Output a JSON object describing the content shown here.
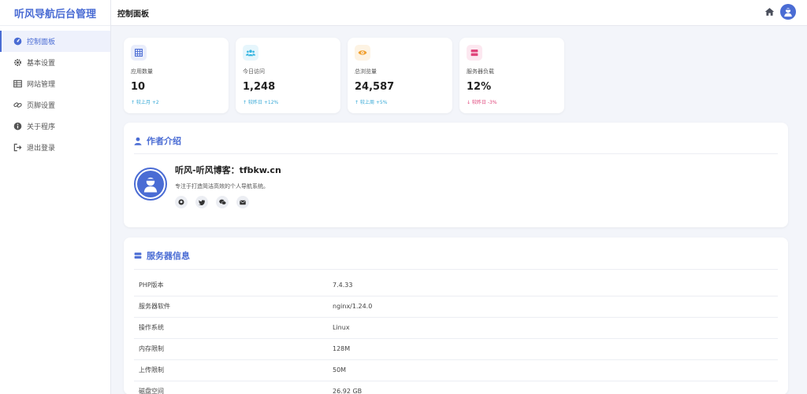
{
  "brand": "听风导航后台管理",
  "menu": [
    {
      "label": "控制面板",
      "icon": "dashboard-icon",
      "active": true
    },
    {
      "label": "基本设置",
      "icon": "gear-icon"
    },
    {
      "label": "网站管理",
      "icon": "table-icon"
    },
    {
      "label": "页脚设置",
      "icon": "link-icon"
    },
    {
      "label": "关于程序",
      "icon": "info-icon"
    },
    {
      "label": "退出登录",
      "icon": "logout-icon"
    }
  ],
  "header": {
    "title": "控制面板"
  },
  "stats": [
    {
      "label": "应用数量",
      "value": "10",
      "trend": "较上月 +2",
      "direction": "up",
      "icon": "grid-icon",
      "color": "#4a6cd4",
      "bg": "#e9edfb"
    },
    {
      "label": "今日访问",
      "value": "1,248",
      "trend": "较昨日 +12%",
      "direction": "up",
      "icon": "users-icon",
      "color": "#35b5e0",
      "bg": "#e6f6fc"
    },
    {
      "label": "总浏览量",
      "value": "24,587",
      "trend": "较上周 +5%",
      "direction": "up",
      "icon": "eye-icon",
      "color": "#f0a030",
      "bg": "#fdf3e3"
    },
    {
      "label": "服务器负载",
      "value": "12%",
      "trend": "较昨日 -3%",
      "direction": "down",
      "icon": "server-icon",
      "color": "#e0457b",
      "bg": "#fce8f0"
    }
  ],
  "author": {
    "title": "作者介绍",
    "name": "听风-听风博客：tfbkw.cn",
    "desc": "专注于打造简洁高效的个人导航系统。",
    "socials": [
      "github-icon",
      "twitter-icon",
      "wechat-icon",
      "mail-icon"
    ]
  },
  "server": {
    "title": "服务器信息",
    "rows": [
      {
        "k": "PHP版本",
        "v": "7.4.33"
      },
      {
        "k": "服务器软件",
        "v": "nginx/1.24.0"
      },
      {
        "k": "操作系统",
        "v": "Linux"
      },
      {
        "k": "内存限制",
        "v": "128M"
      },
      {
        "k": "上传限制",
        "v": "50M"
      },
      {
        "k": "磁盘空间",
        "v": "26.92 GB"
      }
    ]
  }
}
